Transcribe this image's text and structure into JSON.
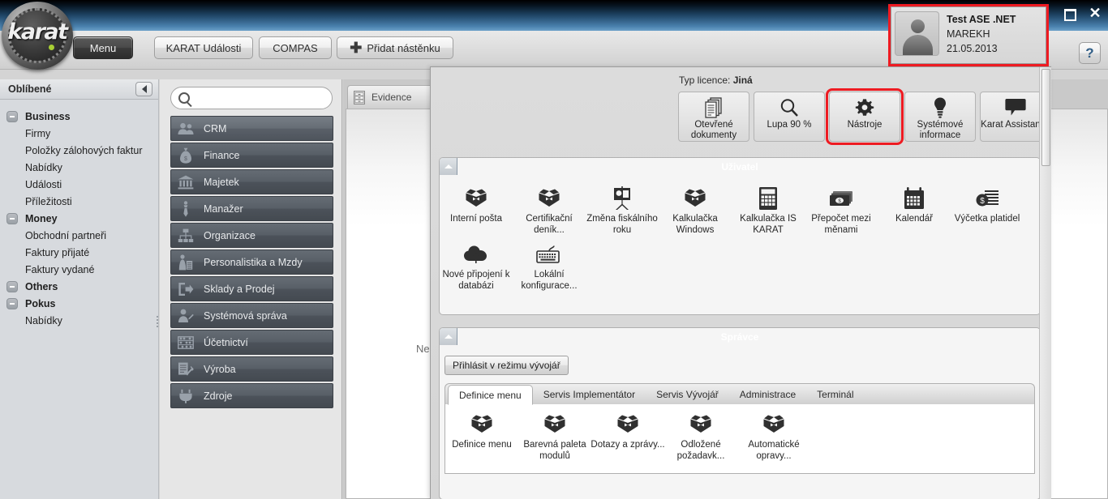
{
  "window": {
    "minimize_label": "–",
    "maximize_label": "□",
    "close_label": "✕",
    "help_label": "?"
  },
  "logo": {
    "text": "karat"
  },
  "toolbar": {
    "menu_label": "Menu",
    "events_label": "KARAT Události",
    "compas_label": "COMPAS",
    "add_board_label": "Přidat nástěnku",
    "add_board_plus": "＋"
  },
  "user_card": {
    "name": "Test ASE .NET",
    "login": "MAREKH",
    "date": "21.05.2013",
    "highlight_color": "#ee1b22"
  },
  "sidebar": {
    "header": "Oblíbené",
    "collapse_icon": "chevron-left-icon",
    "groups": [
      {
        "label": "Business",
        "items": [
          "Firmy",
          "Položky zálohových faktur",
          "Nabídky",
          "Události",
          "Příležitosti"
        ]
      },
      {
        "label": "Money",
        "items": [
          "Obchodní partneři",
          "Faktury přijaté",
          "Faktury vydané"
        ]
      },
      {
        "label": "Others",
        "items": []
      },
      {
        "label": "Pokus",
        "items": [
          "Nabídky"
        ]
      }
    ]
  },
  "modules": {
    "search_placeholder": "",
    "search_value": "",
    "items": [
      {
        "label": "CRM",
        "icon": "people-icon"
      },
      {
        "label": "Finance",
        "icon": "money-bag-icon"
      },
      {
        "label": "Majetek",
        "icon": "bank-icon"
      },
      {
        "label": "Manažer",
        "icon": "tie-icon"
      },
      {
        "label": "Organizace",
        "icon": "org-chart-icon"
      },
      {
        "label": "Personalistika a Mzdy",
        "icon": "person-doc-icon"
      },
      {
        "label": "Sklady a Prodej",
        "icon": "export-box-icon"
      },
      {
        "label": "Systémová správa",
        "icon": "user-edit-icon"
      },
      {
        "label": "Účetnictví",
        "icon": "abacus-icon"
      },
      {
        "label": "Výroba",
        "icon": "clipboard-wrench-icon"
      },
      {
        "label": "Zdroje",
        "icon": "plug-icon"
      }
    ]
  },
  "content": {
    "tab_label": "Evidence",
    "tab_icon": "cabinet-icon",
    "body_text": "Ne"
  },
  "panel": {
    "license_prefix": "Typ licence:",
    "license_value": "Jiná",
    "top_buttons": [
      {
        "label": "Otevřené dokumenty",
        "icon": "documents-icon",
        "highlighted": false
      },
      {
        "label": "Lupa 90 %",
        "icon": "magnifier-icon",
        "highlighted": false
      },
      {
        "label": "Nástroje",
        "icon": "gear-icon",
        "highlighted": true
      },
      {
        "label": "Systémové informace",
        "icon": "bulb-icon",
        "highlighted": false
      },
      {
        "label": "Karat Assistance",
        "icon": "speech-bubble-icon",
        "highlighted": false
      }
    ],
    "sections": [
      {
        "title": "Uživatel",
        "collapse_icon": "triangle-up-icon",
        "tiles_row1": [
          {
            "label": "Interní pošta",
            "icon": "box-icon"
          },
          {
            "label": "Certifikační deník...",
            "icon": "box-icon"
          },
          {
            "label": "Změna fiskálního roku",
            "icon": "presentation-icon"
          },
          {
            "label": "Kalkulačka Windows",
            "icon": "box-icon"
          },
          {
            "label": "Kalkulačka IS KARAT",
            "icon": "calculator-icon"
          },
          {
            "label": "Přepočet mezi měnami",
            "icon": "banknotes-icon"
          },
          {
            "label": "Kalendář",
            "icon": "calendar-icon"
          },
          {
            "label": "Výčetka platidel",
            "icon": "coin-stack-icon"
          }
        ],
        "tiles_row2": [
          {
            "label": "Nové připojení k databázi",
            "icon": "cloud-upload-icon"
          },
          {
            "label": "Lokální konfigurace...",
            "icon": "keyboard-icon"
          }
        ]
      },
      {
        "title": "Správce",
        "collapse_icon": "triangle-up-icon",
        "dev_button": "Přihlásit v režimu vývojář",
        "tabs": [
          {
            "label": "Definice menu",
            "active": true
          },
          {
            "label": "Servis Implementátor",
            "active": false
          },
          {
            "label": "Servis Vývojář",
            "active": false
          },
          {
            "label": "Administrace",
            "active": false
          },
          {
            "label": "Terminál",
            "active": false
          }
        ],
        "tiles_row1": [
          {
            "label": "Definice menu",
            "icon": "box-icon"
          },
          {
            "label": "Barevná paleta modulů",
            "icon": "box-icon"
          },
          {
            "label": "Dotazy a zprávy...",
            "icon": "box-icon"
          },
          {
            "label": "Odložené požadavk...",
            "icon": "box-icon"
          },
          {
            "label": "Automatické opravy...",
            "icon": "box-icon"
          }
        ]
      }
    ]
  }
}
